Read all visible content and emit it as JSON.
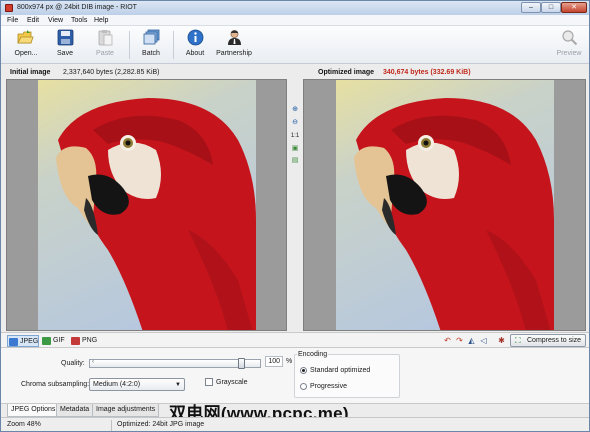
{
  "window": {
    "title": "800x974 px @ 24bit  DIB image - RIOT",
    "min_glyph": "–",
    "max_glyph": "□",
    "close_glyph": "✕"
  },
  "menu": {
    "items": [
      {
        "label": "File"
      },
      {
        "label": "Edit"
      },
      {
        "label": "View"
      },
      {
        "label": "Tools"
      },
      {
        "label": "Help"
      }
    ]
  },
  "toolbar": {
    "open_label": "Open...",
    "save_label": "Save",
    "paste_label": "Paste",
    "batch_label": "Batch",
    "about_label": "About",
    "partnership_label": "Partnership",
    "preview_label": "Preview"
  },
  "panes": {
    "initial": {
      "label": "Initial image",
      "bytes": "2,337,640 bytes (2,282.85 KiB)"
    },
    "optimized": {
      "label": "Optimized image",
      "bytes": "340,674 bytes (332.69 KiB)"
    }
  },
  "zoom": {
    "zoom_in_glyph": "⊕",
    "zoom_out_glyph": "⊖",
    "actual_size": "1:1",
    "fit_glyph": "▣",
    "compare_glyph": "▤"
  },
  "format_tabs": [
    {
      "label": "JPEG"
    },
    {
      "label": "GIF"
    },
    {
      "label": "PNG"
    }
  ],
  "actions": {
    "undo_glyph": "↶",
    "redo_glyph": "↷",
    "flip_glyph": "◭",
    "rotate_glyph": "◁",
    "crop_glyph": "✱",
    "compress_label": "Compress to size",
    "compress_glyph": "⛶"
  },
  "options": {
    "quality_label": "Quality:",
    "quality_value": "100",
    "quality_fraction": 1.0,
    "quality_unit": "%",
    "chroma_label": "Chroma subsampling:",
    "chroma_value": "Medium (4:2:0)",
    "chroma_arrow": "▼",
    "grayscale_label": "Grayscale",
    "grayscale_checked": false,
    "encoding_title": "Encoding",
    "encoding_options": [
      {
        "label": "Standard optimized",
        "selected": true
      },
      {
        "label": "Progressive",
        "selected": false
      }
    ]
  },
  "bottom_tabs": [
    {
      "label": "JPEG Options"
    },
    {
      "label": "Metadata"
    },
    {
      "label": "Image adjustments"
    }
  ],
  "status": {
    "zoom": "Zoom 48%",
    "message": "Optimized: 24bit JPG image"
  },
  "watermark": "双电网(www.pcpc.me)",
  "colors": {
    "title_bar": "#bccfe8",
    "optimized_bytes": "#c0281b",
    "parrot_red": "#c8141c",
    "sky_yellow": "#e4dda0",
    "sky_blue": "#b9cbe0"
  }
}
